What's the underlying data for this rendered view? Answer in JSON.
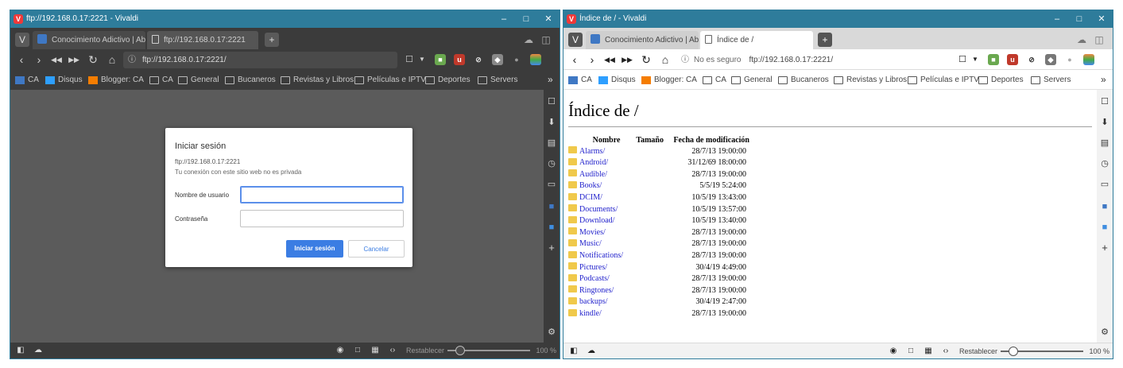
{
  "left": {
    "title": "ftp://192.168.0.17:2221 - Vivaldi",
    "tabs": [
      {
        "label": "Conocimiento Adictivo | Ab"
      },
      {
        "label": "ftp://192.168.0.17:2221"
      }
    ],
    "url": "ftp://192.168.0.17:2221/",
    "bookmarks": [
      "CA",
      "Disqus",
      "Blogger: CA",
      "CA",
      "General",
      "Bucaneros",
      "Revistas y Libros",
      "Películas e IPTV",
      "Deportes",
      "Servers"
    ],
    "dialog": {
      "title": "Iniciar sesión",
      "url": "ftp://192.168.0.17:2221",
      "note": "Tu conexión con este sitio web no es privada",
      "username_label": "Nombre de usuario",
      "password_label": "Contraseña",
      "username_value": "",
      "password_value": "",
      "login_button": "Iniciar sesión",
      "cancel_button": "Cancelar"
    },
    "status": {
      "reset": "Restablecer",
      "zoom": "100 %"
    }
  },
  "right": {
    "title": "Índice de / - Vivaldi",
    "tabs": [
      {
        "label": "Conocimiento Adictivo | Ab"
      },
      {
        "label": "Índice de /"
      }
    ],
    "security": "No es seguro",
    "url": "ftp://192.168.0.17:2221/",
    "bookmarks": [
      "CA",
      "Disqus",
      "Blogger: CA",
      "CA",
      "General",
      "Bucaneros",
      "Revistas y Libros",
      "Películas e IPTV",
      "Deportes",
      "Servers"
    ],
    "page": {
      "heading": "Índice de /",
      "columns": {
        "name": "Nombre",
        "size": "Tamaño",
        "date": "Fecha de modificación"
      },
      "rows": [
        {
          "name": "Alarms/",
          "date": "28/7/13 19:00:00"
        },
        {
          "name": "Android/",
          "date": "31/12/69 18:00:00"
        },
        {
          "name": "Audible/",
          "date": "28/7/13 19:00:00"
        },
        {
          "name": "Books/",
          "date": "5/5/19 5:24:00"
        },
        {
          "name": "DCIM/",
          "date": "10/5/19 13:43:00"
        },
        {
          "name": "Documents/",
          "date": "10/5/19 13:57:00"
        },
        {
          "name": "Download/",
          "date": "10/5/19 13:40:00"
        },
        {
          "name": "Movies/",
          "date": "28/7/13 19:00:00"
        },
        {
          "name": "Music/",
          "date": "28/7/13 19:00:00"
        },
        {
          "name": "Notifications/",
          "date": "28/7/13 19:00:00"
        },
        {
          "name": "Pictures/",
          "date": "30/4/19 4:49:00"
        },
        {
          "name": "Podcasts/",
          "date": "28/7/13 19:00:00"
        },
        {
          "name": "Ringtones/",
          "date": "28/7/13 19:00:00"
        },
        {
          "name": "backups/",
          "date": "30/4/19 2:47:00"
        },
        {
          "name": "kindle/",
          "date": "28/7/13 19:00:00"
        }
      ]
    },
    "status": {
      "reset": "Restablecer",
      "zoom": "100 %"
    }
  },
  "colors": {
    "titlebar": "#2e7c9b",
    "dark_chrome": "#3b3b3b",
    "dialog_primary": "#3b7de3",
    "link": "#2222cc",
    "folder": "#f0c94b"
  },
  "zoom_level": 1.0
}
